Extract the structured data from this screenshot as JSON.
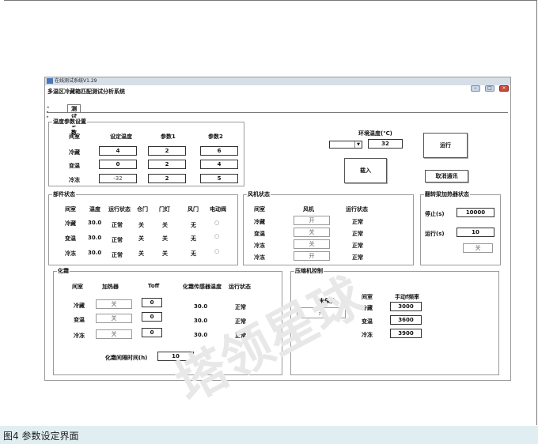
{
  "window": {
    "title": "在线测试系统V1.29",
    "app_title": "多温区冷藏箱匹配测试分析系统",
    "controls": [
      "–",
      "□",
      "×"
    ]
  },
  "tabs": {
    "nav": "◂ ▸ ▸",
    "active": "测试参数"
  },
  "temp": {
    "title": "温度参数设置",
    "headers": [
      "间室",
      "设定温度",
      "参数1",
      "参数2"
    ],
    "rows": [
      {
        "name": "冷藏",
        "set": "4",
        "p1": "2",
        "p2": "6"
      },
      {
        "name": "变温",
        "set": "0",
        "p1": "2",
        "p2": "4"
      },
      {
        "name": "冷冻",
        "set": "-32",
        "p1": "2",
        "p2": "5"
      }
    ]
  },
  "env": {
    "label": "环境温度(℃)",
    "value": "32"
  },
  "buttons": {
    "run": "运行",
    "load": "载入",
    "clear": "取消通讯"
  },
  "parts": {
    "title": "部件状态",
    "headers": [
      "间室",
      "温度",
      "运行状态",
      "仓门",
      "门灯",
      "风门",
      "电动阀"
    ],
    "rows": [
      {
        "name": "冷藏",
        "temp": "30.0",
        "state": "正常",
        "door": "关",
        "light": "关",
        "damper": "无",
        "valve": "○"
      },
      {
        "name": "变温",
        "temp": "30.0",
        "state": "正常",
        "door": "关",
        "light": "关",
        "damper": "无",
        "valve": "○"
      },
      {
        "name": "冷冻",
        "temp": "30.0",
        "state": "正常",
        "door": "关",
        "light": "关",
        "damper": "无",
        "valve": "○"
      }
    ]
  },
  "fans": {
    "title": "风机状态",
    "headers": [
      "间室",
      "风机",
      "运行状态"
    ],
    "rows": [
      {
        "name": "冷藏",
        "btn": "开",
        "state": "正常"
      },
      {
        "name": "变温",
        "btn": "关",
        "state": "正常"
      },
      {
        "name": "冷冻",
        "btn": "关",
        "state": "正常"
      },
      {
        "name": "冷冻",
        "btn": "开",
        "state": "正常"
      }
    ]
  },
  "heater": {
    "title": "翻转梁加热器状态",
    "stop_label": "停止(s)",
    "stop_value": "10000",
    "run_label": "运行(s)",
    "run_value": "10",
    "btn": "关"
  },
  "defrost": {
    "title": "化霜",
    "headers": [
      "间室",
      "加热器",
      "Toff",
      "化霜传感器温度",
      "运行状态"
    ],
    "rows": [
      {
        "name": "冷藏",
        "btn": "关",
        "toff": "0",
        "sensor": "30.0",
        "state": "正常"
      },
      {
        "name": "变温",
        "btn": "关",
        "toff": "0",
        "sensor": "30.0",
        "state": "正常"
      },
      {
        "name": "冷冻",
        "btn": "关",
        "toff": "0",
        "sensor": "30.0",
        "state": "正常"
      }
    ],
    "interval_label": "化霜间隔时间(h)",
    "interval_value": "10"
  },
  "compressor": {
    "title": "压缩机控制",
    "protect_label": "未保护",
    "protect_btn": "开",
    "headers": [
      "间室",
      "手动f频率"
    ],
    "rows": [
      {
        "name": "冷藏",
        "value": "3000"
      },
      {
        "name": "变温",
        "value": "3600"
      },
      {
        "name": "冷冻",
        "value": "3900"
      }
    ]
  },
  "caption": "图4  参数设定界面",
  "watermark": "塔领星球"
}
